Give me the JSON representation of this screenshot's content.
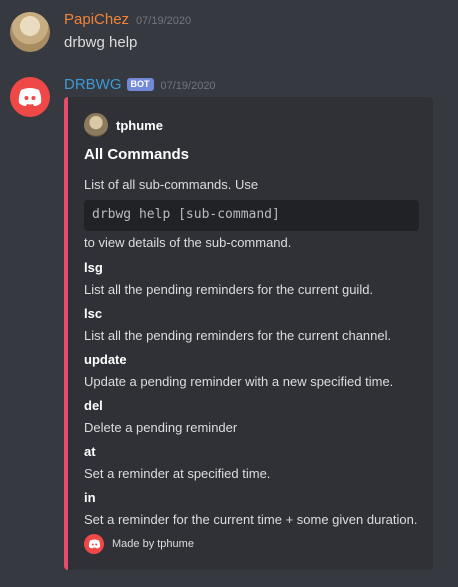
{
  "messages": [
    {
      "username": "PapiChez",
      "username_color": "#f0833a",
      "timestamp": "07/19/2020",
      "content": "drbwg help"
    },
    {
      "username": "DRBWG",
      "username_color": "#3b9bd8",
      "bot_tag": "BOT",
      "timestamp": "07/19/2020"
    }
  ],
  "embed": {
    "color": "#e74c6a",
    "author": "tphume",
    "title": "All Commands",
    "description_line1": "List of all sub-commands. Use",
    "code": "drbwg help [sub-command]",
    "description_line2": "to view details of the sub-command.",
    "fields": [
      {
        "name": "lsg",
        "value": "List all the pending reminders for the current guild."
      },
      {
        "name": "lsc",
        "value": "List all the pending reminders for the current channel."
      },
      {
        "name": "update",
        "value": "Update a pending reminder with a new specified time."
      },
      {
        "name": "del",
        "value": "Delete a pending reminder"
      },
      {
        "name": "at",
        "value": "Set a reminder at specified time."
      },
      {
        "name": "in",
        "value": "Set a reminder for the current time + some given duration."
      }
    ],
    "footer": "Made by tphume"
  }
}
